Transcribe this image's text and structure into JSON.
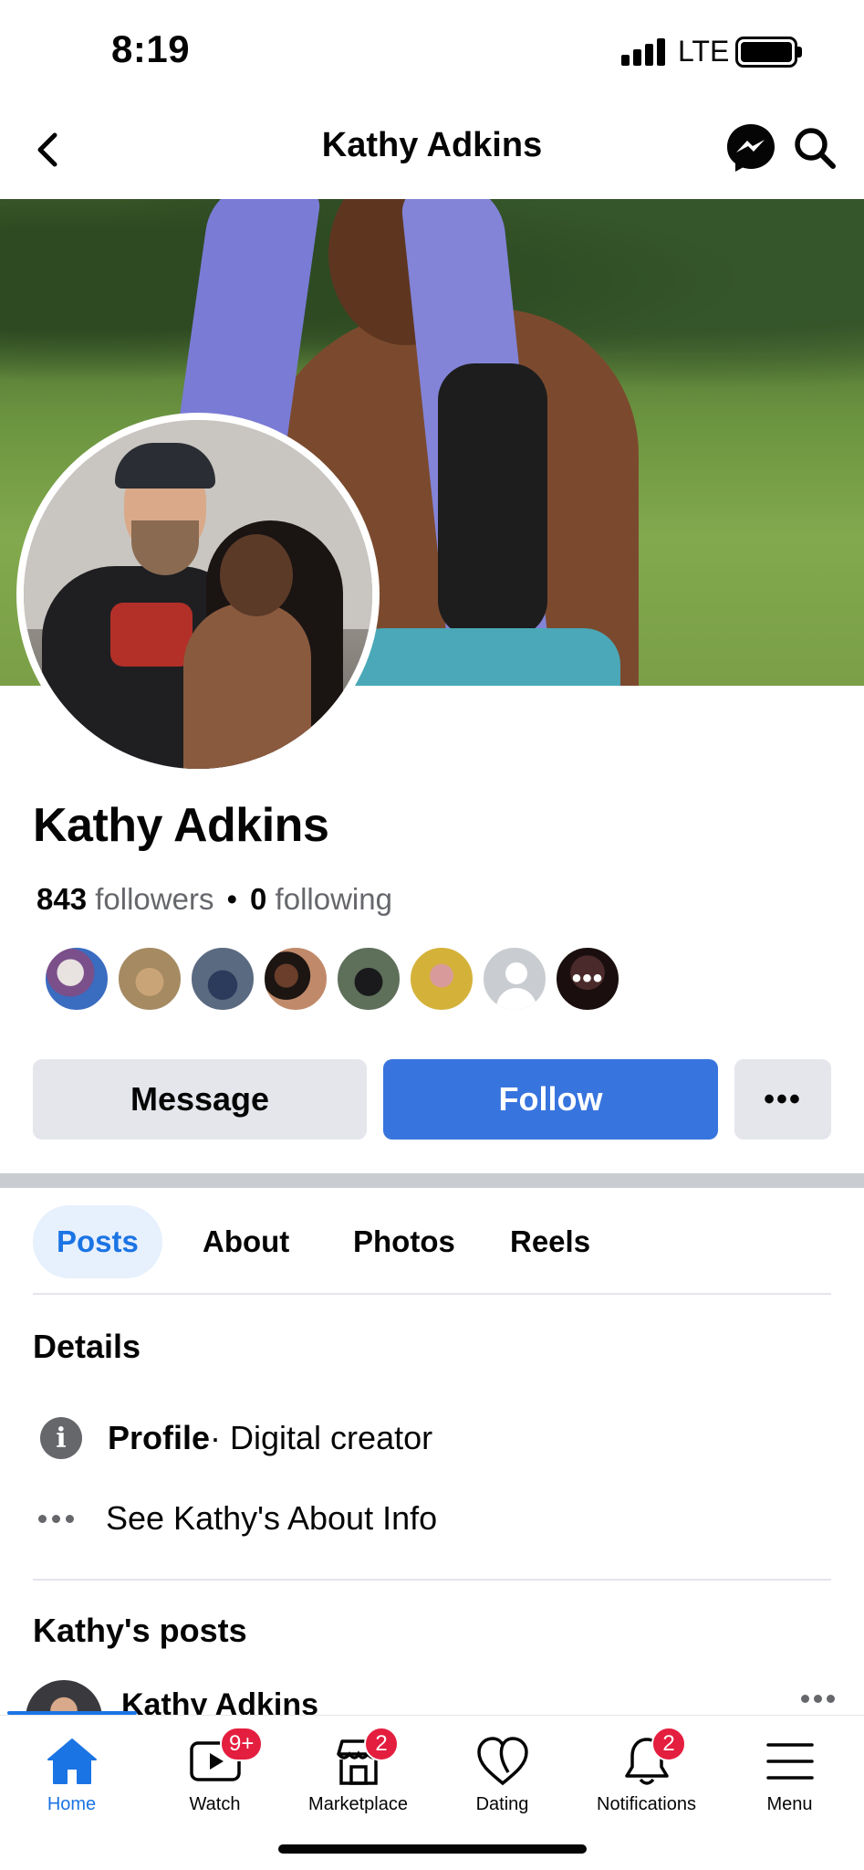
{
  "status_bar": {
    "time": "8:19",
    "network": "LTE"
  },
  "header": {
    "title": "Kathy Adkins"
  },
  "profile": {
    "name": "Kathy Adkins",
    "followers_count": "843",
    "followers_label": "followers",
    "following_count": "0",
    "following_label": "following",
    "more_followers_label": "•••"
  },
  "actions": {
    "message": "Message",
    "follow": "Follow",
    "more": "•••"
  },
  "tabs": [
    {
      "label": "Posts",
      "active": true
    },
    {
      "label": "About",
      "active": false
    },
    {
      "label": "Photos",
      "active": false
    },
    {
      "label": "Reels",
      "active": false
    }
  ],
  "details": {
    "title": "Details",
    "profile_label": "Profile",
    "profile_value": " · Digital creator",
    "see_about": "See Kathy's About Info"
  },
  "posts": {
    "title": "Kathy's posts",
    "first_author": "Kathy Adkins"
  },
  "bottom_nav": [
    {
      "label": "Home",
      "icon": "home-icon",
      "badge": ""
    },
    {
      "label": "Watch",
      "icon": "watch-icon",
      "badge": "9+"
    },
    {
      "label": "Marketplace",
      "icon": "marketplace-icon",
      "badge": "2"
    },
    {
      "label": "Dating",
      "icon": "dating-icon",
      "badge": ""
    },
    {
      "label": "Notifications",
      "icon": "bell-icon",
      "badge": "2"
    },
    {
      "label": "Menu",
      "icon": "menu-icon",
      "badge": ""
    }
  ],
  "colors": {
    "accent": "#1b74e4",
    "follow_button": "#3874de",
    "badge": "#e41e3f",
    "secondary_button": "#e4e6eb"
  }
}
